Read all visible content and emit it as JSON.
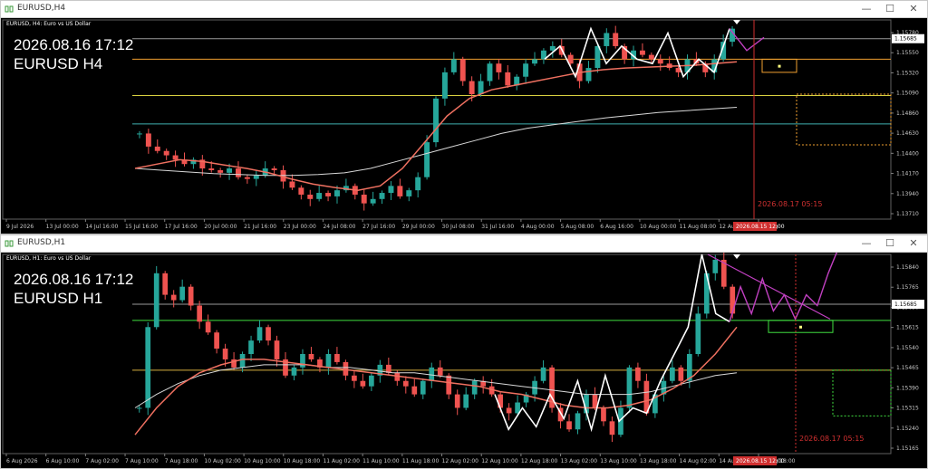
{
  "windows": [
    {
      "id": "h4",
      "title": "EURUSD,H4",
      "header_symbol": "EURUSD, H4: Euro vs US Dollar",
      "overlay_datetime": "2026.08.16 17:12",
      "overlay_symbol": "EURUSD H4",
      "current_price": "1.15685",
      "price_labels": [
        "1.15780",
        "1.15550",
        "1.15320",
        "1.15090",
        "1.14860",
        "1.14630",
        "1.14400",
        "1.14170",
        "1.13940",
        "1.13710"
      ],
      "time_labels": [
        "9 Jul 2026",
        "13 Jul 00:00",
        "14 Jul 16:00",
        "15 Jul 16:00",
        "17 Jul 16:00",
        "20 Jul 00:00",
        "21 Jul 16:00",
        "23 Jul 00:00",
        "24 Jul 08:00",
        "27 Jul 16:00",
        "29 Jul 00:00",
        "30 Jul 08:00",
        "31 Jul 16:00",
        "4 Aug 00:00",
        "5 Aug 08:00",
        "6 Aug 16:00",
        "10 Aug 00:00",
        "11 Aug 08:00",
        "12 Aug 16:00",
        "14 Aug"
      ],
      "highlight_time": "2026.08.15 12:00",
      "future_marker": "2026.08.17 05:15",
      "price_range": [
        1.1362,
        1.159
      ],
      "hlines": [
        {
          "price": 1.15685,
          "color": "#9a9a9a"
        },
        {
          "price": 1.1545,
          "color": "#f0a030"
        },
        {
          "price": 1.15035,
          "color": "#d8d040"
        },
        {
          "price": 1.1471,
          "color": "#40b0b0"
        }
      ],
      "candles_start": 1.146,
      "candles_path": [
        1.146,
        1.1445,
        1.144,
        1.1435,
        1.143,
        1.1425,
        1.143,
        1.142,
        1.1418,
        1.1415,
        1.142,
        1.141,
        1.1408,
        1.1412,
        1.142,
        1.1418,
        1.1405,
        1.1398,
        1.139,
        1.1385,
        1.1392,
        1.1388,
        1.1395,
        1.14,
        1.139,
        1.138,
        1.1385,
        1.1392,
        1.14,
        1.1388,
        1.1395,
        1.141,
        1.145,
        1.15,
        1.153,
        1.1545,
        1.152,
        1.1505,
        1.152,
        1.154,
        1.153,
        1.1515,
        1.1525,
        1.154,
        1.1545,
        1.1555,
        1.156,
        1.155,
        1.154,
        1.152,
        1.1535,
        1.156,
        1.1575,
        1.156,
        1.1545,
        1.1555,
        1.155,
        1.1545,
        1.154,
        1.1535,
        1.153,
        1.1545,
        1.154,
        1.153,
        1.1545,
        1.1565,
        1.158
      ],
      "ma_red": [
        1.142,
        1.1425,
        1.143,
        1.1428,
        1.1424,
        1.142,
        1.1415,
        1.1408,
        1.1402,
        1.1398,
        1.1395,
        1.14,
        1.142,
        1.145,
        1.148,
        1.15,
        1.151,
        1.1515,
        1.152,
        1.1525,
        1.153,
        1.1533,
        1.1535,
        1.1536,
        1.1537,
        1.1538,
        1.154,
        1.1542
      ],
      "ma_white": [
        1.142,
        1.1418,
        1.1416,
        1.1414,
        1.1413,
        1.1412,
        1.1412,
        1.1413,
        1.1415,
        1.142,
        1.1428,
        1.1436,
        1.1444,
        1.1452,
        1.146,
        1.1466,
        1.147,
        1.1474,
        1.1478,
        1.1481,
        1.1484,
        1.1486,
        1.1488,
        1.149
      ],
      "zigzag": [
        1.1545,
        1.156,
        1.1525,
        1.158,
        1.154,
        1.156,
        1.1545,
        1.154,
        1.1575,
        1.1525,
        1.1545,
        1.153,
        1.158
      ],
      "projection": [
        1.158,
        1.1555,
        1.157
      ],
      "box_top": 1.1545,
      "box_bottom": 1.153,
      "box_point": 1.1537,
      "dotted_box_top": 1.1505,
      "dotted_box_bottom": 1.1447
    },
    {
      "id": "h1",
      "title": "EURUSD,H1",
      "header_symbol": "EURUSD, H1: Euro vs US Dollar",
      "overlay_datetime": "2026.08.16 17:12",
      "overlay_symbol": "EURUSD H1",
      "current_price": "1.15685",
      "price_labels": [
        "1.15840",
        "1.15765",
        "1.15690",
        "1.15615",
        "1.15540",
        "1.15465",
        "1.15390",
        "1.15315",
        "1.15240",
        "1.15165"
      ],
      "time_labels": [
        "6 Aug 2026",
        "6 Aug 10:00",
        "7 Aug 02:00",
        "7 Aug 10:00",
        "7 Aug 18:00",
        "10 Aug 02:00",
        "10 Aug 10:00",
        "10 Aug 18:00",
        "11 Aug 02:00",
        "11 Aug 10:00",
        "11 Aug 18:00",
        "12 Aug 02:00",
        "12 Aug 10:00",
        "12 Aug 18:00",
        "13 Aug 02:00",
        "13 Aug 10:00",
        "13 Aug 18:00",
        "14 Aug 02:00",
        "14 Aug 10:00",
        "14 Aug 18:00"
      ],
      "highlight_time": "2026.08.15 12:00",
      "future_marker": "2026.08.17 05:15",
      "price_range": [
        1.1513,
        1.1587
      ],
      "hlines": [
        {
          "price": 1.15685,
          "color": "#9a9a9a"
        },
        {
          "price": 1.15625,
          "color": "#40e040"
        },
        {
          "price": 1.1544,
          "color": "#d8b040"
        }
      ],
      "candles_start": 1.153,
      "candles_path": [
        1.153,
        1.156,
        1.158,
        1.1572,
        1.157,
        1.1575,
        1.1568,
        1.1562,
        1.1558,
        1.1552,
        1.1548,
        1.1545,
        1.155,
        1.1555,
        1.156,
        1.1555,
        1.1548,
        1.1542,
        1.1545,
        1.155,
        1.1548,
        1.1545,
        1.155,
        1.1547,
        1.1542,
        1.154,
        1.1538,
        1.1542,
        1.1546,
        1.1543,
        1.154,
        1.1538,
        1.1535,
        1.154,
        1.1545,
        1.1542,
        1.1535,
        1.153,
        1.1535,
        1.154,
        1.1538,
        1.1535,
        1.153,
        1.1528,
        1.1532,
        1.1535,
        1.154,
        1.1545,
        1.153,
        1.1525,
        1.1522,
        1.1528,
        1.1535,
        1.153,
        1.1525,
        1.152,
        1.153,
        1.1545,
        1.154,
        1.1528,
        1.1535,
        1.154,
        1.1545,
        1.154,
        1.155,
        1.1565,
        1.158,
        1.1585,
        1.1575,
        1.1565
      ],
      "ma_red": [
        1.152,
        1.153,
        1.1538,
        1.1543,
        1.1546,
        1.1548,
        1.1548,
        1.1547,
        1.1546,
        1.1545,
        1.1544,
        1.1543,
        1.1542,
        1.1541,
        1.154,
        1.1539,
        1.1538,
        1.1536,
        1.1535,
        1.1533,
        1.1531,
        1.153,
        1.153,
        1.1531,
        1.1533,
        1.1537,
        1.1542,
        1.155,
        1.156
      ],
      "ma_white": [
        1.153,
        1.1535,
        1.1539,
        1.1542,
        1.1544,
        1.1545,
        1.1546,
        1.1546,
        1.1546,
        1.1545,
        1.1545,
        1.1544,
        1.1543,
        1.1543,
        1.1542,
        1.1541,
        1.154,
        1.1539,
        1.1538,
        1.1537,
        1.1536,
        1.1535,
        1.1535,
        1.1535,
        1.1536,
        1.1538,
        1.154,
        1.1542,
        1.1543
      ],
      "zigzag": [
        1.1535,
        1.1522,
        1.153,
        1.1523,
        1.1535,
        1.1526,
        1.154,
        1.1522,
        1.1542,
        1.1525,
        1.153,
        1.1528,
        1.154,
        1.155,
        1.156,
        1.1587,
        1.1565,
        1.1562
      ],
      "projection": [
        1.1562,
        1.1575,
        1.1565,
        1.1578,
        1.1566,
        1.1572,
        1.1563,
        1.1572,
        1.1568,
        1.158,
        1.159
      ],
      "trend_line": [
        1.1587,
        1.1563
      ],
      "box_top": 1.15625,
      "box_bottom": 1.1558,
      "box_point": 1.156,
      "dotted_box_top": 1.1544,
      "dotted_box_bottom": 1.1527
    }
  ],
  "colors": {
    "background": "#000000",
    "bull": "#26a69a",
    "bear": "#ef5350",
    "ma_red": "#ef7060",
    "ma_white": "#d8d8d8",
    "zigzag": "#ffffff",
    "projection": "#c040c0",
    "vline": "#d03030",
    "highlight_bg": "#d03030"
  },
  "controls": {
    "minimize": "—",
    "maximize": "☐",
    "close": "✕"
  }
}
